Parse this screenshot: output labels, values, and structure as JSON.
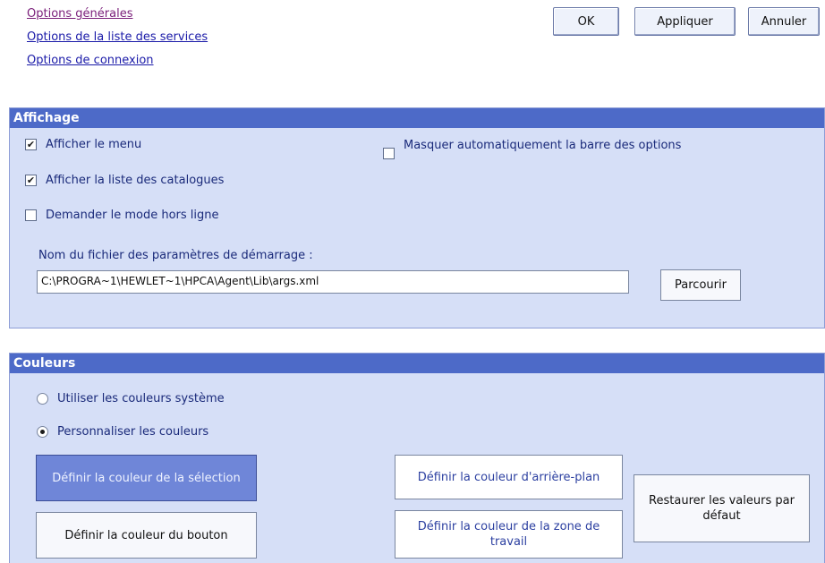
{
  "nav": {
    "general": "Options générales",
    "services": "Options de la liste des services",
    "connection": "Options de connexion"
  },
  "top_buttons": {
    "ok": "OK",
    "apply": "Appliquer",
    "cancel": "Annuler"
  },
  "display": {
    "header": "Affichage",
    "show_menu": "Afficher le menu",
    "show_menu_checked": true,
    "show_catalog": "Afficher la liste des catalogues",
    "show_catalog_checked": true,
    "offline_mode": "Demander le mode hors ligne",
    "offline_mode_checked": false,
    "auto_hide": "Masquer automatiquement la barre des options",
    "auto_hide_checked": false,
    "startup_label": "Nom du fichier des paramètres de démarrage :",
    "startup_value": "C:\\PROGRA~1\\HEWLET~1\\HPCA\\Agent\\Lib\\args.xml",
    "browse": "Parcourir"
  },
  "colors": {
    "header": "Couleurs",
    "system_colors": "Utiliser les couleurs système",
    "custom_colors": "Personnaliser les couleurs",
    "selected_option": "custom",
    "set_selection": "Définir la couleur de la sélection",
    "set_button": "Définir la couleur du bouton",
    "set_background": "Définir la couleur d'arrière-plan",
    "set_workspace": "Définir la couleur de la zone de travail",
    "restore_defaults": "Restaurer les valeurs par défaut"
  },
  "palette": {
    "panel_bg": "#d6dff7",
    "header_bg": "#4d6ac8",
    "selection_btn": "#6f86d8"
  }
}
